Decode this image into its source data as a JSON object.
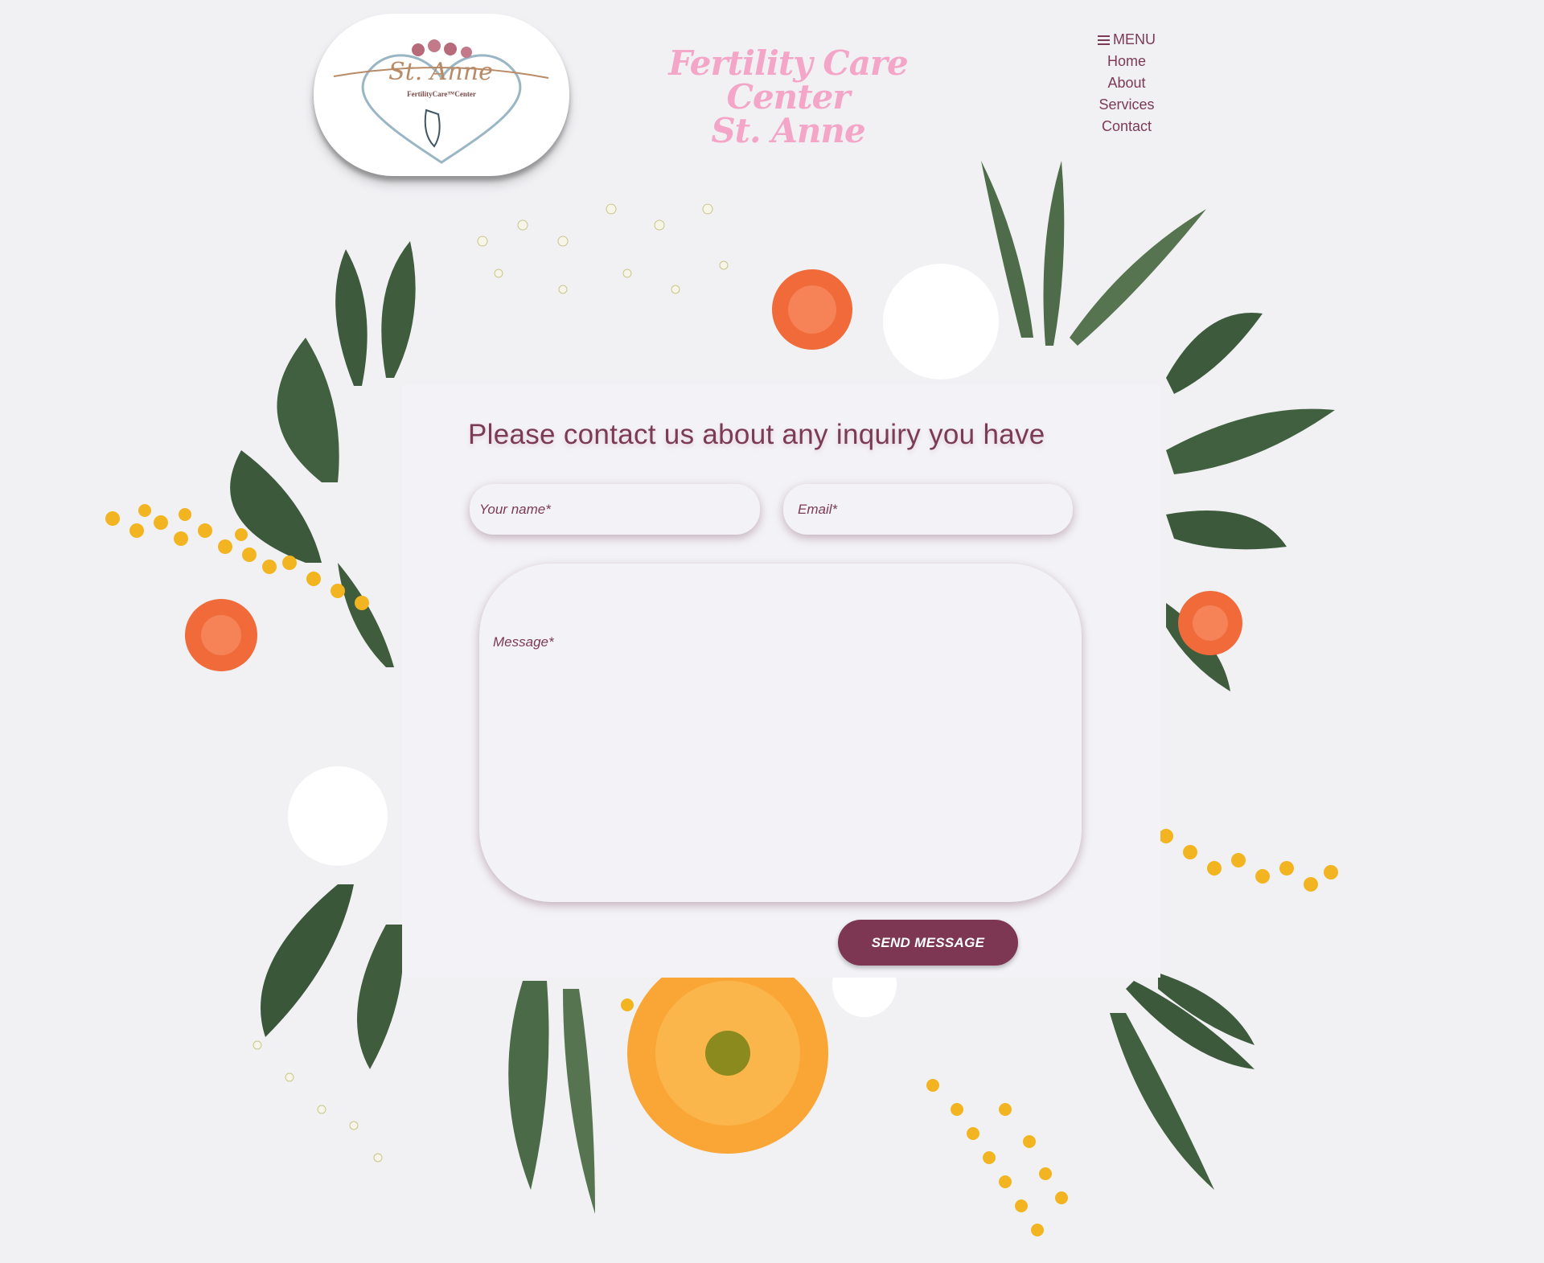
{
  "logo": {
    "name": "St. Anne",
    "subtitle": "FertilityCare™Center"
  },
  "brand": {
    "line1": "Fertility Care Center",
    "line2": "St. Anne"
  },
  "nav": {
    "menu_label": "MENU",
    "items": [
      "Home",
      "About",
      "Services",
      "Contact"
    ]
  },
  "form": {
    "title": "Please contact us about any inquiry you have",
    "name_placeholder": "Your name*",
    "email_placeholder": "Email*",
    "message_placeholder": "Message*",
    "submit_label": "SEND MESSAGE"
  },
  "colors": {
    "accent": "#7d3752",
    "brand_pink": "#f4a6c8",
    "background": "#f1f1f4"
  }
}
